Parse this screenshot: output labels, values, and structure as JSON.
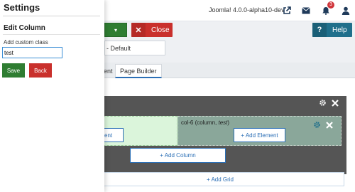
{
  "colors": {
    "save": "#2f7d32",
    "close": "#c9302c",
    "help": "#1f6f8b",
    "link": "#2b6fb6"
  },
  "header": {
    "version": "Joomla! 4.0.0-alpha10-dev",
    "icons": [
      "external-link-icon",
      "mail-icon",
      "bell-icon",
      "user-icon"
    ],
    "notification_count": "3"
  },
  "toolbar": {
    "save_dropdown_icon": "chevron-down-icon",
    "close_label": "Close",
    "help_label": "Help"
  },
  "template_style": {
    "value": "- Default"
  },
  "tabs": [
    {
      "label": "ent",
      "active": false
    },
    {
      "label": "Page Builder",
      "active": true
    }
  ],
  "builder": {
    "column_title": "col-6 (column, ",
    "column_class": "test",
    "column_title_end": ")",
    "add_element_left": "ement",
    "add_element": "+ Add Element",
    "add_column": "+ Add Column",
    "add_grid": "+ Add Grid"
  },
  "panel": {
    "title": "Settings",
    "subtitle": "Edit Column",
    "field_label": "Add custom class",
    "field_value": "test",
    "save_label": "Save",
    "back_label": "Back"
  }
}
